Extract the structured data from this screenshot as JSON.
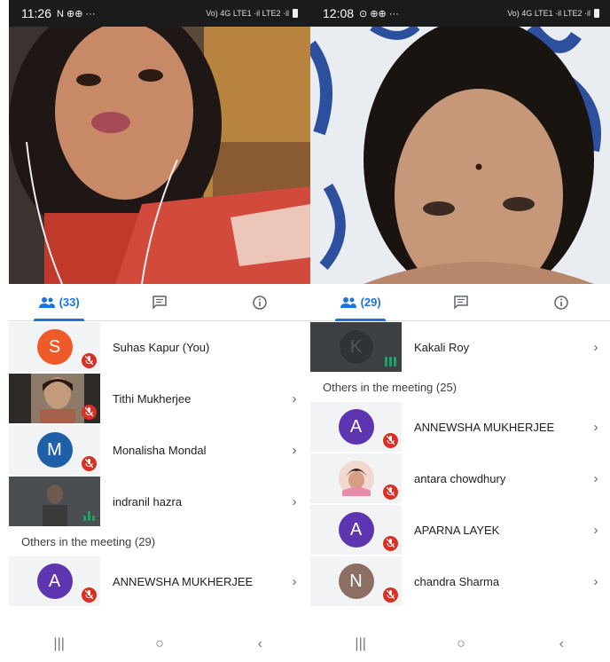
{
  "left": {
    "status": {
      "time": "11:26",
      "icons": "N ⊕⊕ ···",
      "signal": "Vo) 4G LTE1 ·il LTE2 ·il"
    },
    "tabs": {
      "people_count": "(33)"
    },
    "participants": [
      {
        "initial": "S",
        "name": "Suhas Kapur (You)",
        "color": "#f05a28",
        "muted": true,
        "chevron": false,
        "type": "avatar"
      },
      {
        "initial": "",
        "name": "Tithi Mukherjee",
        "color": "",
        "muted": true,
        "chevron": true,
        "type": "photo"
      },
      {
        "initial": "M",
        "name": "Monalisha Mondal",
        "color": "#1f5fa8",
        "muted": true,
        "chevron": true,
        "type": "avatar"
      },
      {
        "initial": "",
        "name": "indranil hazra",
        "color": "",
        "muted": false,
        "chevron": true,
        "type": "speaking-photo"
      }
    ],
    "others_header": "Others in the meeting (29)",
    "others": [
      {
        "initial": "A",
        "name": "ANNEWSHA MUKHERJEE",
        "color": "#5e35b1",
        "muted": true,
        "chevron": true
      }
    ]
  },
  "right": {
    "status": {
      "time": "12:08",
      "icons": "⊙ ⊕⊕ ···",
      "signal": "Vo) 4G LTE1 ·il LTE2 ·il"
    },
    "tabs": {
      "people_count": "(29)"
    },
    "participants": [
      {
        "initial": "K",
        "name": "Kakali Roy",
        "color": "#333",
        "muted": false,
        "chevron": true,
        "type": "speaking-dark"
      }
    ],
    "others_header": "Others in the meeting (25)",
    "others": [
      {
        "initial": "A",
        "name": "ANNEWSHA MUKHERJEE",
        "color": "#5e35b1",
        "muted": true,
        "chevron": true,
        "type": "avatar"
      },
      {
        "initial": "",
        "name": "antara chowdhury",
        "color": "#f3c8c0",
        "muted": true,
        "chevron": true,
        "type": "photo-round"
      },
      {
        "initial": "A",
        "name": "APARNA LAYEK",
        "color": "#5e35b1",
        "muted": true,
        "chevron": true,
        "type": "avatar"
      },
      {
        "initial": "N",
        "name": "chandra Sharma",
        "color": "#8d6e63",
        "muted": true,
        "chevron": true,
        "type": "avatar"
      }
    ]
  },
  "icons": {
    "people": "people-icon",
    "chat": "chat-icon",
    "info": "info-icon",
    "mic_off": "mic-off-icon",
    "chevron": "›"
  },
  "navbar": {
    "recents": "|||",
    "home": "○",
    "back": "‹"
  }
}
